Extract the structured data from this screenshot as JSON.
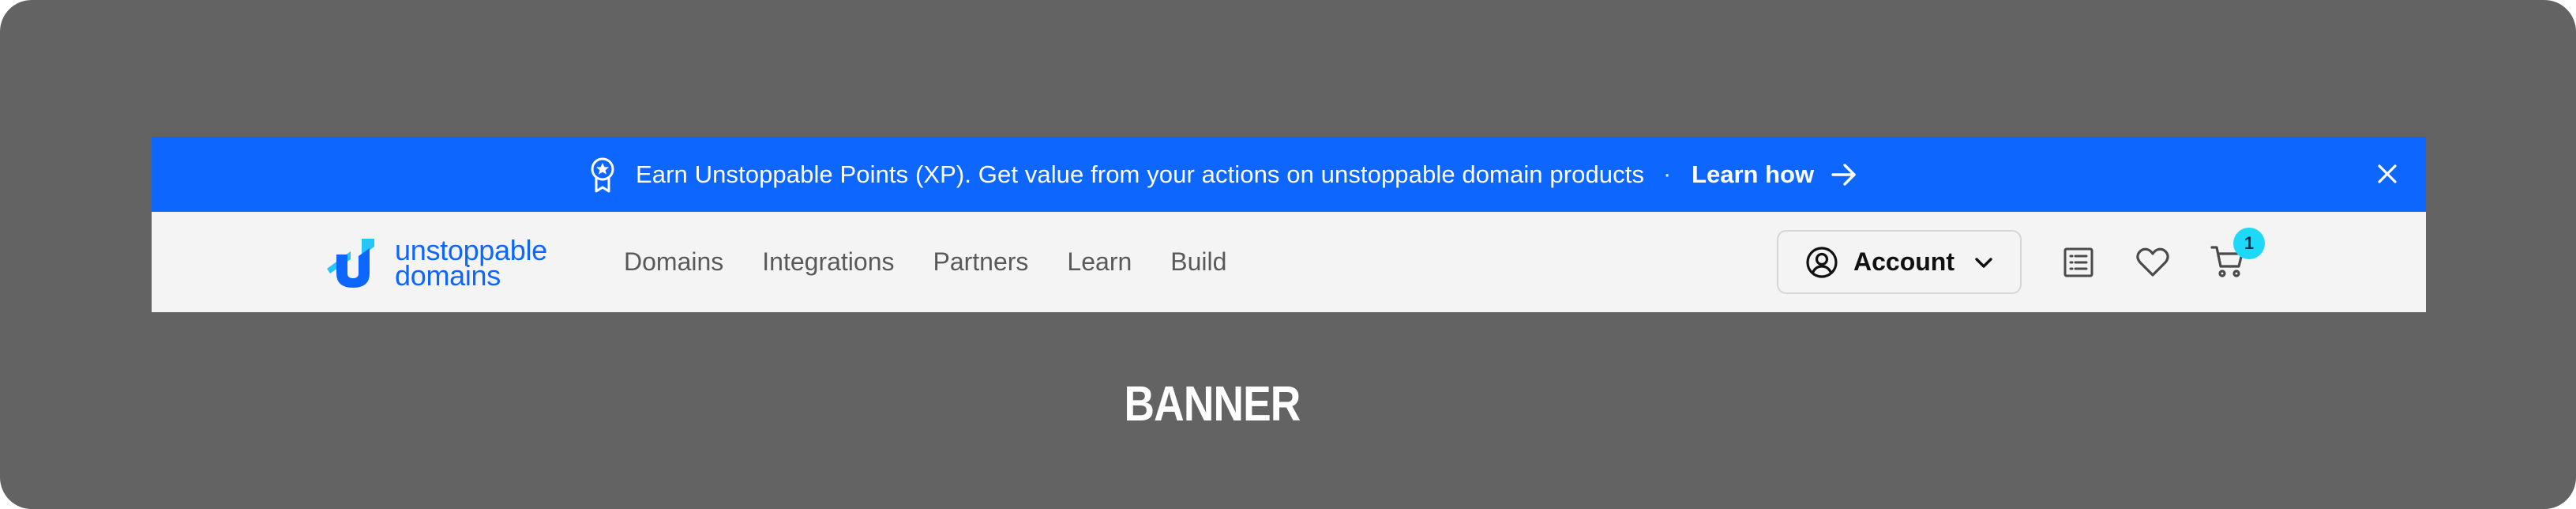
{
  "promo": {
    "icon": "award-ribbon-icon",
    "text": "Earn Unstoppable Points (XP). Get value from your actions on unstoppable domain products",
    "separator": "·",
    "link_label": "Learn how",
    "link_icon": "arrow-right-icon",
    "close_icon": "close-icon",
    "background": "#0d67fe"
  },
  "nav": {
    "logo": {
      "line1": "unstoppable",
      "line2": "domains",
      "color": "#0d67fe"
    },
    "links": [
      "Domains",
      "Integrations",
      "Partners",
      "Learn",
      "Build"
    ],
    "account_label": "Account",
    "cart_count": "1",
    "icons": [
      "user-circle-icon",
      "chevron-down-icon",
      "list-icon",
      "heart-icon",
      "cart-icon"
    ]
  },
  "caption": "BANNER"
}
